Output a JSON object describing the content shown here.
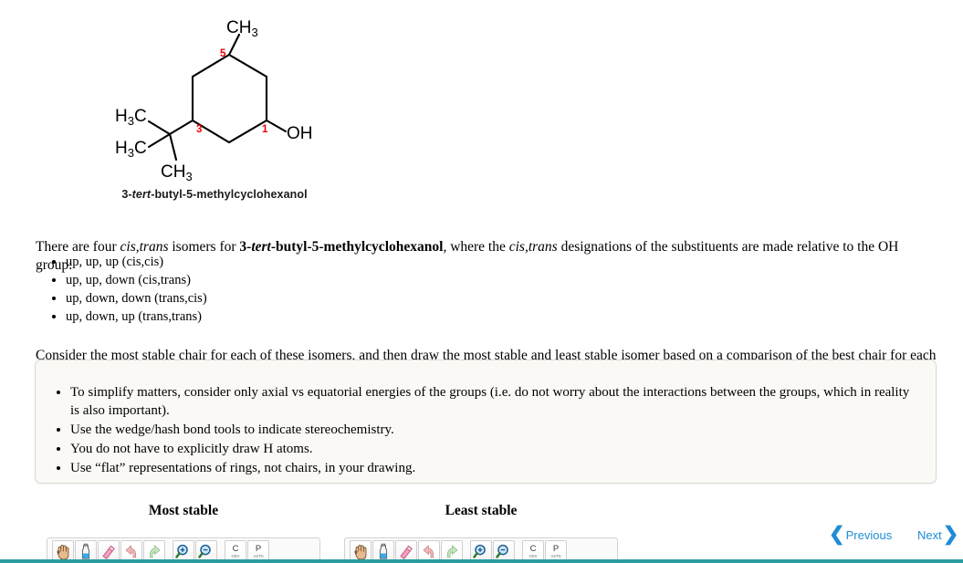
{
  "molecule": {
    "caption_prefix": "3-",
    "caption_italic": "tert",
    "caption_suffix": "-butyl-5-methylcyclohexanol",
    "labels": {
      "top_methyl": "CH3",
      "oh": "OH",
      "tbu_methyl_1": "H3C",
      "tbu_methyl_2": "H3C",
      "tbu_methyl_3": "CH3",
      "locant_1": "1",
      "locant_3": "3",
      "locant_5": "5"
    },
    "locant_color": "#ee0000",
    "bond_color": "#000000"
  },
  "intro": {
    "text_part1": "There are four ",
    "italic1": "cis,trans",
    "text_part2": " isomers for ",
    "bold_name_prefix": "3-",
    "bold_name_italic": "tert",
    "bold_name_suffix": "-butyl-5-methylcyclohexanol",
    "text_part3": ", where the ",
    "italic2": "cis,trans",
    "text_part4": " designations of the substituents are made relative to the OH group:"
  },
  "isomers": [
    "up, up, up (cis,cis)",
    "up, up, down (cis,trans)",
    "up, down, down (trans,cis)",
    "up, down, up (trans,trans)"
  ],
  "consider_text": "Consider the most stable chair for each of these isomers, and then draw the most stable and least stable isomer based on a comparison of the best chair for each one.",
  "instructions": [
    "To simplify matters, consider only axial vs equatorial energies of the groups (i.e. do not worry about the interactions between the groups, which in reality is also important).",
    "Use the wedge/hash bond tools to indicate stereochemistry.",
    "You do not have to explicitly draw H atoms.",
    "Use “flat” representations of rings, not chairs, in your drawing."
  ],
  "answers": {
    "most_stable_heading": "Most stable",
    "least_stable_heading": "Least stable"
  },
  "toolbar": {
    "tools": [
      {
        "name": "pan-hand-tool",
        "title": "Pan"
      },
      {
        "name": "eyedropper-tool",
        "title": "Eyedropper"
      },
      {
        "name": "eraser-tool",
        "title": "Eraser"
      },
      {
        "name": "undo-tool",
        "title": "Undo"
      },
      {
        "name": "redo-tool",
        "title": "Redo"
      },
      {
        "name": "zoom-in-tool",
        "title": "Zoom in"
      },
      {
        "name": "zoom-out-tool",
        "title": "Zoom out"
      }
    ],
    "copy_button": {
      "big": "C",
      "small": "ODV"
    },
    "paste_button": {
      "big": "P",
      "small": "ASTN"
    }
  },
  "pager": {
    "previous_label": "Previous",
    "next_label": "Next",
    "previous_chevron": "❮",
    "next_chevron": "❯",
    "link_color": "#1f8dd6"
  },
  "colors": {
    "accent_bar": "#2a9d9f",
    "callout_background": "#faf9f5",
    "callout_border": "#d9d9d4"
  }
}
